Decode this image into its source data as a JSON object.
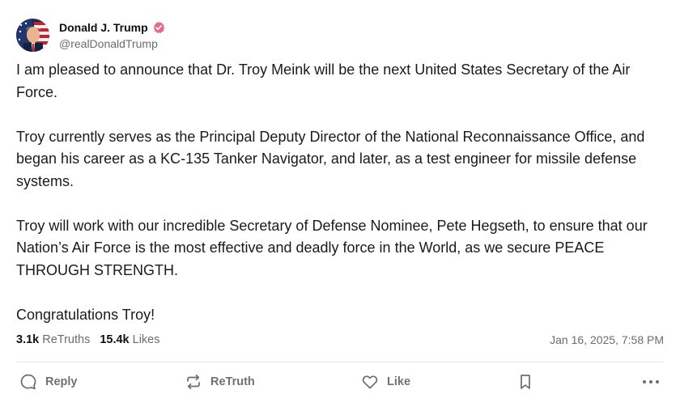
{
  "author": {
    "display_name": "Donald J. Trump",
    "handle": "@realDonaldTrump",
    "verified": true,
    "verified_color": "#e86a8a"
  },
  "post": {
    "paragraphs": [
      "I am pleased to announce that Dr. Troy Meink will be the next United States Secretary of the Air Force.",
      "Troy currently serves as the Principal Deputy Director of the National Reconnaissance Office, and began his career as a KC-135 Tanker Navigator, and later, as a test engineer for missile defense systems.",
      "Troy will work with our incredible Secretary of Defense Nominee, Pete Hegseth, to ensure that our Nation’s Air Force is the most effective and deadly force in the World, as we secure PEACE THROUGH STRENGTH.",
      "Congratulations Troy!"
    ]
  },
  "stats": {
    "retruths_count": "3.1k",
    "retruths_label": "ReTruths",
    "likes_count": "15.4k",
    "likes_label": "Likes",
    "timestamp": "Jan 16, 2025, 7:58 PM"
  },
  "actions": {
    "reply": {
      "label": "Reply",
      "icon": "speech-bubble-icon"
    },
    "retruth": {
      "label": "ReTruth",
      "icon": "repost-arrows-icon"
    },
    "like": {
      "label": "Like",
      "icon": "heart-icon"
    },
    "bookmark": {
      "icon": "bookmark-icon"
    },
    "more": {
      "icon": "more-dots-icon"
    }
  },
  "colors": {
    "text": "#1a1a1a",
    "muted": "#6b6b72",
    "divider": "#e6e6ea"
  }
}
